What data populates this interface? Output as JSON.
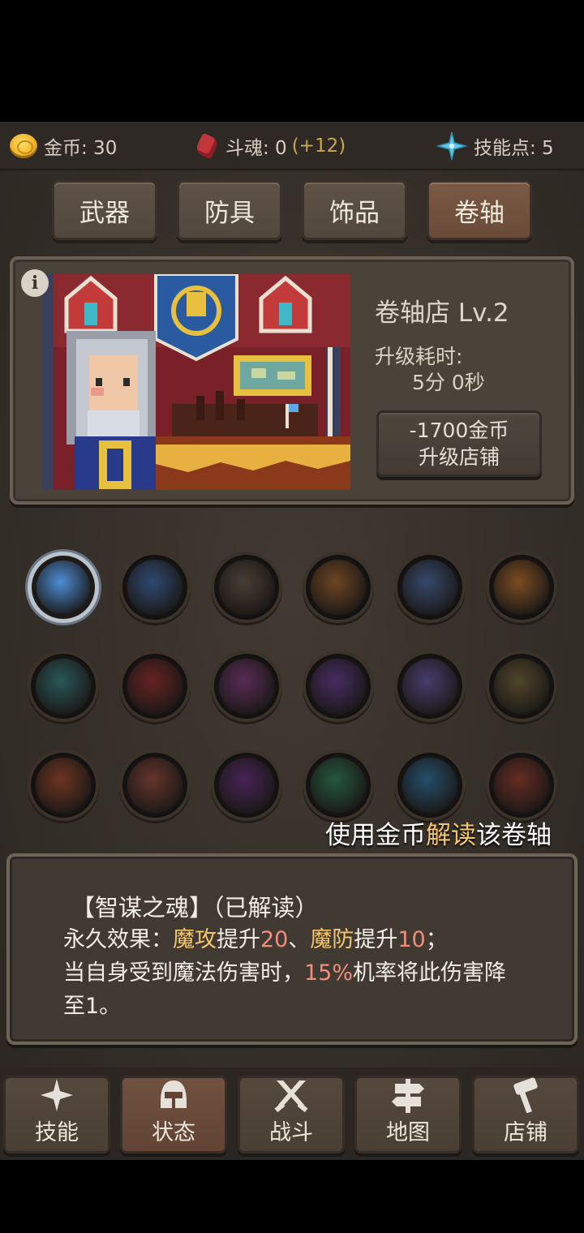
{
  "resources": {
    "gold": {
      "label": "金币: 30",
      "icon": "gold-coin-icon"
    },
    "soul": {
      "label": "斗魂: 0",
      "bonus": "(+12)",
      "icon": "soul-crystal-icon"
    },
    "skill_points": {
      "label": "技能点: 5",
      "icon": "sparkle-icon"
    }
  },
  "tabs": [
    {
      "label": "武器",
      "active": false
    },
    {
      "label": "防具",
      "active": false
    },
    {
      "label": "饰品",
      "active": false
    },
    {
      "label": "卷轴",
      "active": true
    }
  ],
  "shop": {
    "info_icon": "i",
    "title": "卷轴店 Lv.2",
    "upgrade_time_label": "升级耗时:",
    "upgrade_time_value": "5分 0秒",
    "upgrade_cost": "-1700金币",
    "upgrade_action": "升级店铺"
  },
  "scrolls": [
    {
      "name": "scroll-ice-icon",
      "color": "#4d8fd6",
      "selected": true
    },
    {
      "name": "scroll-lightning-icon",
      "color": "#3d6fb8"
    },
    {
      "name": "scroll-rune-icon",
      "color": "#6b5a4a"
    },
    {
      "name": "scroll-flame-icon",
      "color": "#b0682a"
    },
    {
      "name": "scroll-frost-tree-icon",
      "color": "#4a6fb0"
    },
    {
      "name": "scroll-fire-burst-icon",
      "color": "#c8762a"
    },
    {
      "name": "scroll-orb-icon",
      "color": "#2f8a8a"
    },
    {
      "name": "scroll-slash-icon",
      "color": "#a02a2a"
    },
    {
      "name": "scroll-shadow-icon",
      "color": "#8a3a8a"
    },
    {
      "name": "scroll-demon-mask-icon",
      "color": "#6a3aa0"
    },
    {
      "name": "scroll-crystal-burst-icon",
      "color": "#6a5ab0"
    },
    {
      "name": "scroll-sword-stone-icon",
      "color": "#7a6a3a"
    },
    {
      "name": "scroll-claw-icon",
      "color": "#b04a2a"
    },
    {
      "name": "scroll-vortex-icon",
      "color": "#a04a3a"
    },
    {
      "name": "scroll-web-icon",
      "color": "#6a2a8a"
    },
    {
      "name": "scroll-heart-shield-icon",
      "color": "#2a8a5a"
    },
    {
      "name": "scroll-storm-icon",
      "color": "#2a7ab0"
    },
    {
      "name": "scroll-beast-icon",
      "color": "#a03a2a"
    }
  ],
  "hint": {
    "before": "使用金币",
    "highlight": "解读",
    "after": "该卷轴"
  },
  "description": {
    "title": "【智谋之魂】（已解读）",
    "line1": {
      "p1": "永久效果：",
      "p2": "魔攻",
      "p3": "提升",
      "p4": "20",
      "p5": "、",
      "p6": "魔防",
      "p7": "提升",
      "p8": "10",
      "p9": "；"
    },
    "line2": {
      "p1": "当自身受到魔法伤害时，",
      "p2": "15%",
      "p3": "机率将此伤害降"
    },
    "line3": "至1。"
  },
  "nav": [
    {
      "label": "技能",
      "icon": "sparkle-icon",
      "active": false
    },
    {
      "label": "状态",
      "icon": "helmet-icon",
      "active": true
    },
    {
      "label": "战斗",
      "icon": "crossed-swords-icon",
      "active": false
    },
    {
      "label": "地图",
      "icon": "signpost-icon",
      "active": false
    },
    {
      "label": "店铺",
      "icon": "hammer-icon",
      "active": false
    }
  ]
}
